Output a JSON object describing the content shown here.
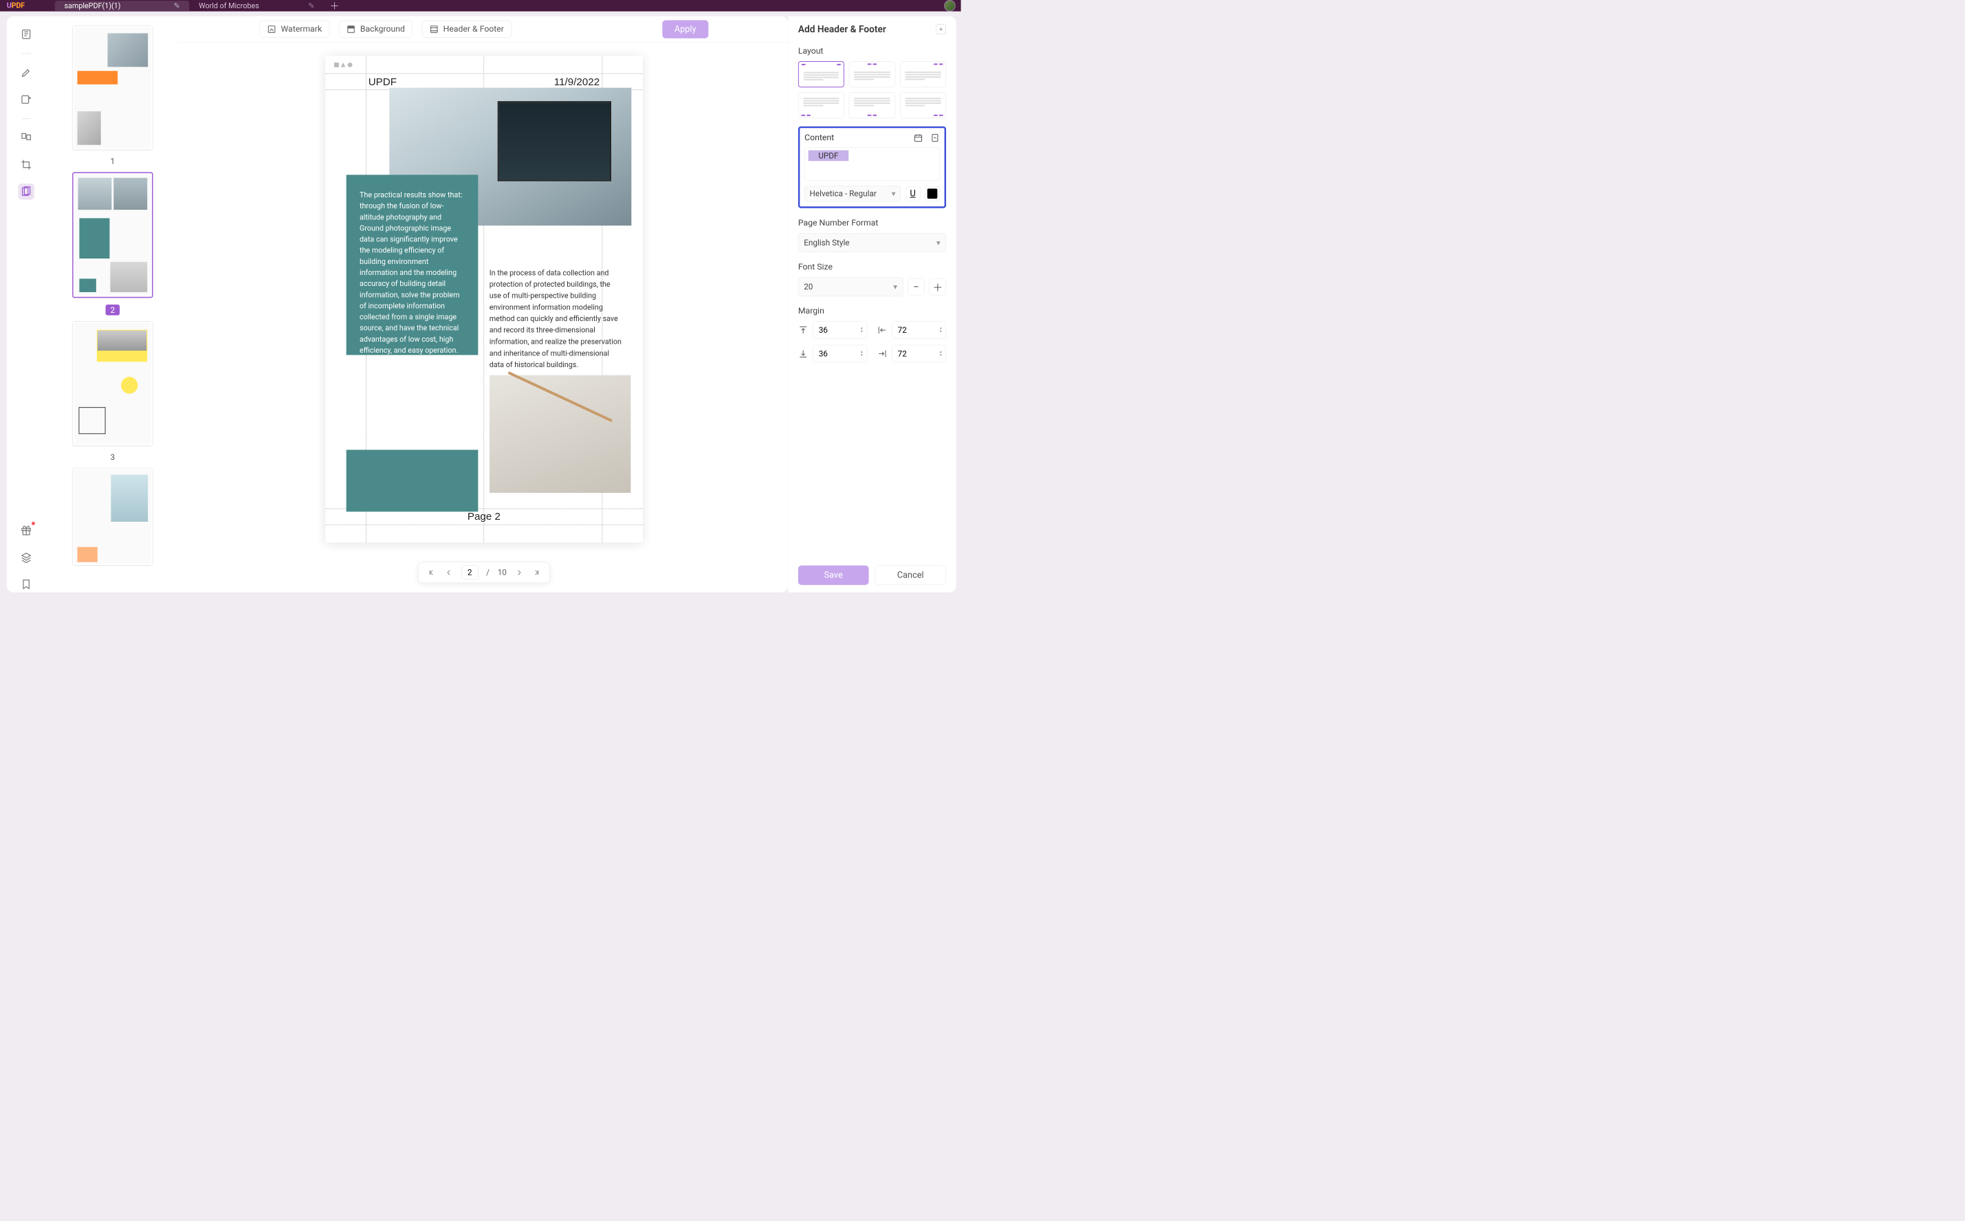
{
  "titlebar": {
    "logo_a": "U",
    "logo_b": "PDF",
    "tabs": [
      {
        "label": "samplePDF(1)(1)",
        "active": true
      },
      {
        "label": "World of Microbes",
        "active": false
      }
    ]
  },
  "rail_tools": [
    "reader-icon",
    "highlighter-icon",
    "comment-icon",
    "organize-icon",
    "crop-icon",
    "page-tools-icon"
  ],
  "thumbs": [
    "1",
    "2",
    "3"
  ],
  "thumbs_selected": 2,
  "topbar": {
    "watermark": "Watermark",
    "background": "Background",
    "headerfooter": "Header & Footer",
    "apply": "Apply"
  },
  "page": {
    "header_left": "UPDF",
    "header_right": "11/9/2022",
    "footer": "Page 2",
    "teal_text": "The practical results show that: through the fusion of low-altitude photography and Ground photographic image data can significantly improve the modeling efficiency of building environment information and the modeling accuracy of building detail information, solve the problem of incomplete information collected from a single image source, and have the technical advantages of low cost, high efficiency, and easy operation.",
    "body_text": "In the process of data collection and protection of protected buildings, the use of multi-perspective building environment information modeling method can quickly and efficiently save and record its three-dimensional information, and realize the preservation and inheritance of multi-dimensional data of historical buildings."
  },
  "pager": {
    "current": "2",
    "sep": "/",
    "total": "10"
  },
  "panel": {
    "title": "Add Header & Footer",
    "layout_label": "Layout",
    "content_label": "Content",
    "content_value": "UPDF",
    "font_family": "Helvetica - Regular",
    "pnf_label": "Page Number Format",
    "pnf_value": "English Style",
    "fs_label": "Font Size",
    "fs_value": "20",
    "margin_label": "Margin",
    "margins": {
      "top": "36",
      "left": "72",
      "bottom": "36",
      "right": "72"
    },
    "save": "Save",
    "cancel": "Cancel",
    "text_color": "#000000"
  }
}
